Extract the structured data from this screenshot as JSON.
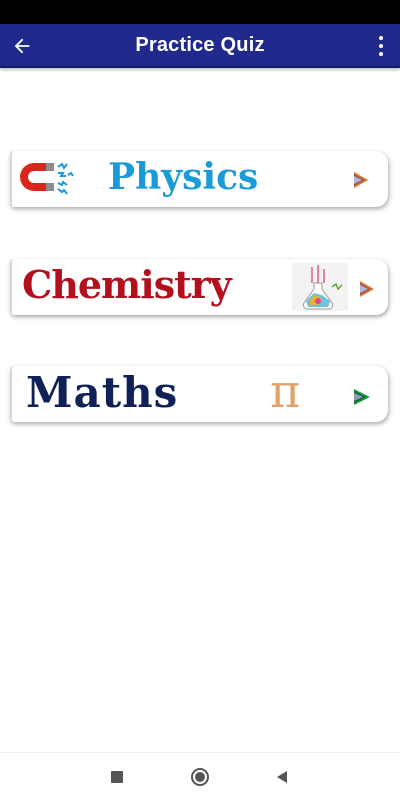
{
  "app_bar": {
    "title": "Practice Quiz",
    "back_icon": "arrow-left-icon",
    "menu_icon": "more-vert-icon",
    "color": "#1f2a8c"
  },
  "subjects": [
    {
      "label": "Physics",
      "icon": "magnet-icon",
      "label_color": "#1a9bd7",
      "chevron_color": "#e0742a"
    },
    {
      "label": "Chemistry",
      "icon": "flask-icon",
      "label_color": "#b2101d",
      "chevron_color": "#e0742a"
    },
    {
      "label": "Maths",
      "icon": "pi-icon",
      "glyph": "π",
      "label_color": "#0f2156",
      "chevron_color": "#1a9a3a"
    }
  ],
  "nav_bar": {
    "recents_icon": "square-icon",
    "home_icon": "circle-icon",
    "back_icon": "triangle-back-icon"
  }
}
